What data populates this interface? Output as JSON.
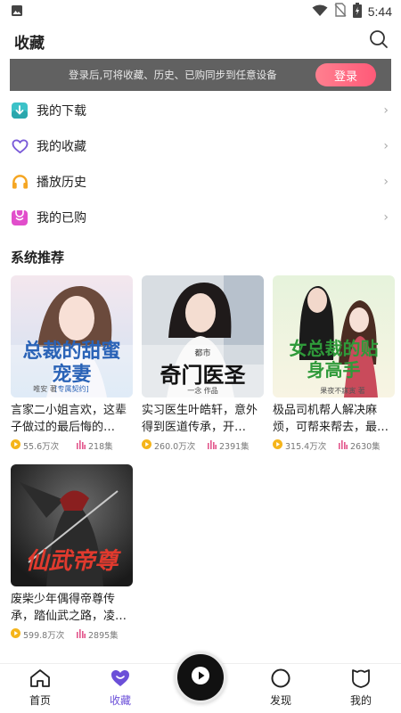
{
  "status_bar": {
    "time": "5:44",
    "icons": [
      "image-icon",
      "wifi-icon",
      "no-sim-icon",
      "battery-charging-icon"
    ]
  },
  "header": {
    "title": "收藏",
    "search_icon": "search-icon"
  },
  "login_banner": {
    "hint": "登录后,可将收藏、历史、已购同步到任意设备",
    "button_label": "登录"
  },
  "menu": {
    "items": [
      {
        "label": "我的下载",
        "icon": "download-icon",
        "color": "#3cc2c8"
      },
      {
        "label": "我的收藏",
        "icon": "heart-icon",
        "color": "#7a5ad8"
      },
      {
        "label": "播放历史",
        "icon": "headphones-icon",
        "color": "#f5a623"
      },
      {
        "label": "我的已购",
        "icon": "purchase-bag-icon",
        "color": "#e14ecb"
      }
    ]
  },
  "recommend": {
    "title": "系统推荐",
    "books": [
      {
        "cover_title": "总裁的甜蜜宠妻",
        "cover_subtitle": "[专属契约]",
        "cover_author": "唯安 著",
        "desc": "言家二小姐言欢，这辈子做过的最后悔的…",
        "plays": "55.6万次",
        "episodes": "218集"
      },
      {
        "cover_title": "奇门医圣",
        "cover_subtitle": "都市",
        "cover_author": "一念 作品",
        "desc": "实习医生叶皓轩，意外得到医道传承，开…",
        "plays": "260.0万次",
        "episodes": "2391集"
      },
      {
        "cover_title": "女总裁的贴身高手",
        "cover_subtitle": "",
        "cover_author": "果夜不寐寅 著",
        "desc": "极品司机帮人解决麻烦，可帮来帮去，最…",
        "plays": "315.4万次",
        "episodes": "2630集"
      },
      {
        "cover_title": "仙武帝尊",
        "cover_subtitle": "",
        "cover_author": "",
        "desc": "废柴少年偶得帝尊传承，踏仙武之路，凌…",
        "plays": "599.8万次",
        "episodes": "2895集"
      }
    ]
  },
  "bottom_nav": {
    "items": [
      {
        "label": "首页",
        "icon": "home-icon"
      },
      {
        "label": "收藏",
        "icon": "heart-icon"
      },
      {
        "label": "发现",
        "icon": "discover-circle-icon"
      },
      {
        "label": "我的",
        "icon": "profile-shield-icon"
      }
    ],
    "active": "收藏",
    "accent": "#6b4fd8"
  }
}
